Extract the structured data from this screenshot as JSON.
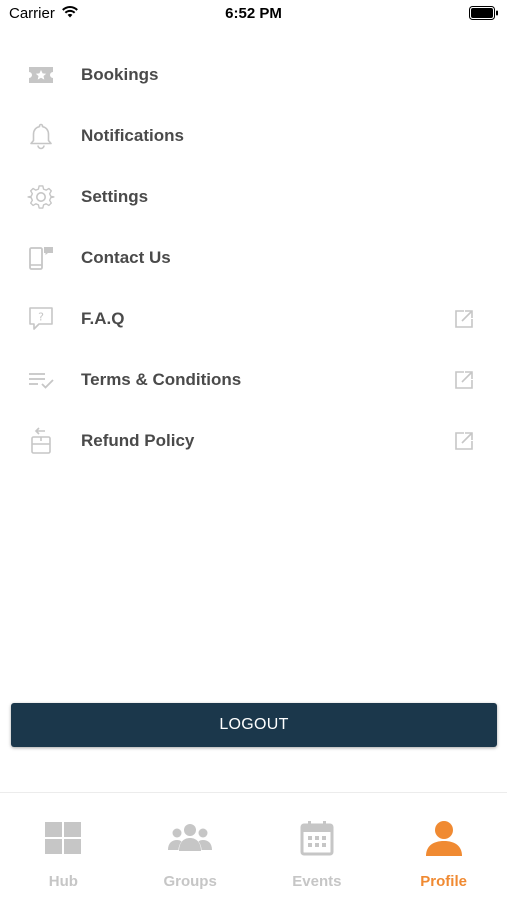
{
  "status_bar": {
    "carrier": "Carrier",
    "time": "6:52 PM"
  },
  "menu": {
    "items": [
      {
        "label": "Bookings",
        "icon": "ticket-icon",
        "external": false
      },
      {
        "label": "Notifications",
        "icon": "bell-icon",
        "external": false
      },
      {
        "label": "Settings",
        "icon": "gear-icon",
        "external": false
      },
      {
        "label": "Contact Us",
        "icon": "contact-device-icon",
        "external": false
      },
      {
        "label": "F.A.Q",
        "icon": "question-bubble-icon",
        "external": true
      },
      {
        "label": "Terms & Conditions",
        "icon": "checklist-icon",
        "external": true
      },
      {
        "label": "Refund Policy",
        "icon": "refund-icon",
        "external": true
      }
    ]
  },
  "logout": {
    "label": "LOGOUT"
  },
  "tab_bar": {
    "tabs": [
      {
        "label": "Hub",
        "icon": "grid-icon",
        "active": false
      },
      {
        "label": "Groups",
        "icon": "people-icon",
        "active": false
      },
      {
        "label": "Events",
        "icon": "calendar-icon",
        "active": false
      },
      {
        "label": "Profile",
        "icon": "person-icon",
        "active": true
      }
    ]
  },
  "colors": {
    "primary_dark": "#1b374b",
    "accent": "#f08a32",
    "icon_gray": "#c6c6c6",
    "text": "#4a4a4a"
  }
}
